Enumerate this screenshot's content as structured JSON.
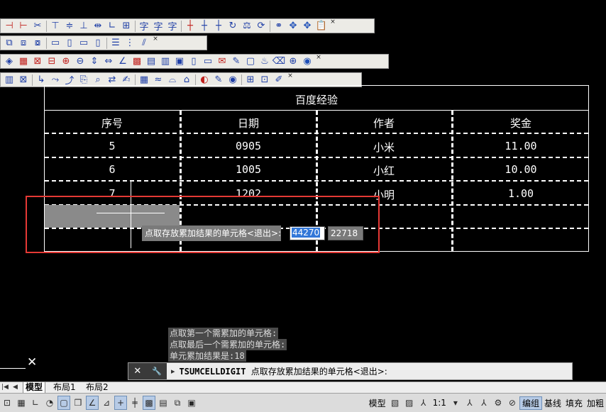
{
  "table": {
    "title": "百度经验",
    "headers": [
      "序号",
      "日期",
      "作者",
      "奖金"
    ],
    "rows": [
      [
        "5",
        "0905",
        "小米",
        "11.00"
      ],
      [
        "6",
        "1005",
        "小红",
        "10.00"
      ],
      [
        "7",
        "1202",
        "小明",
        "1.00"
      ]
    ]
  },
  "prompt": {
    "message": "点取存放累加结果的单元格<退出>:",
    "input_value": "44270",
    "coord_value": "22718"
  },
  "history": [
    "点取第一个需累加的单元格:",
    "点取最后一个需累加的单元格:",
    "单元累加结果是:18"
  ],
  "command": {
    "name": "TSUMCELLDIGIT",
    "message": "点取存放累加结果的单元格<退出>:",
    "close_glyph": "✕",
    "settings_glyph": "🔧",
    "prompt_glyph": "▸"
  },
  "layout_tabs": [
    "模型",
    "布局1",
    "布局2"
  ],
  "status": {
    "model": "模型",
    "scale": "1:1",
    "labels": [
      "编组",
      "基线",
      "填充",
      "加粗"
    ]
  },
  "toolbar_close": "×",
  "highlight_color": "#e53935",
  "selection_fill": "#8a8a8a"
}
